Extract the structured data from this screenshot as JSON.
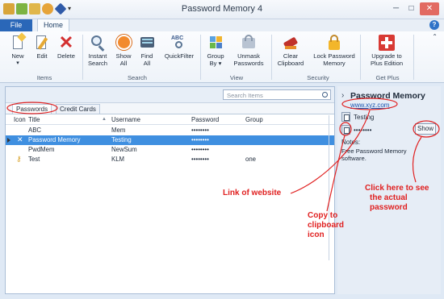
{
  "window": {
    "title": "Password Memory 4"
  },
  "tabs": {
    "file": "File",
    "home": "Home"
  },
  "ribbon": {
    "buttons": {
      "new": "New",
      "edit": "Edit",
      "delete": "Delete",
      "instant_search": [
        "Instant",
        "Search"
      ],
      "show_all": [
        "Show",
        "All"
      ],
      "find_all": [
        "Find",
        "All"
      ],
      "quick_filter": "QuickFilter",
      "group_by": [
        "Group",
        "By"
      ],
      "unmask": [
        "Unmask",
        "Passwords"
      ],
      "clear_clipboard": [
        "Clear",
        "Clipboard"
      ],
      "lock_memory": [
        "Lock Password",
        "Memory"
      ],
      "upgrade": [
        "Upgrade to",
        "Plus Edition"
      ]
    },
    "groups": {
      "items": "Items",
      "search": "Search",
      "view": "View",
      "security": "Security",
      "get_plus": "Get Plus"
    }
  },
  "list": {
    "search_placeholder": "Search Items",
    "subtabs": [
      "Passwords",
      "Credit Cards"
    ],
    "columns": [
      "Icon",
      "Title",
      "Username",
      "Password",
      "Group"
    ],
    "rows": [
      {
        "title": "ABC",
        "username": "Mem",
        "password": "••••••••",
        "group": ""
      },
      {
        "title": "Password Memory",
        "username": "Testing",
        "password": "••••••••",
        "group": ""
      },
      {
        "title": "PwdMem",
        "username": "NewSum",
        "password": "••••••••",
        "group": ""
      },
      {
        "title": "Test",
        "username": "KLM",
        "password": "••••••••",
        "group": "one"
      }
    ]
  },
  "details": {
    "title": "Password Memory",
    "link": "www.xyz.com",
    "username": "Testing",
    "password": "••••••••",
    "show_label": "Show",
    "notes_label": "Notes:",
    "notes": "Free Password Memory software."
  },
  "annotations": {
    "link": "Link of website",
    "copy": [
      "Copy to",
      "clipboard",
      "icon"
    ],
    "show": [
      "Click here to see",
      "the actual",
      "password"
    ]
  },
  "colors": {
    "accent": "#2a67b8",
    "selection": "#3f8fe0",
    "annotation": "#e02020"
  }
}
